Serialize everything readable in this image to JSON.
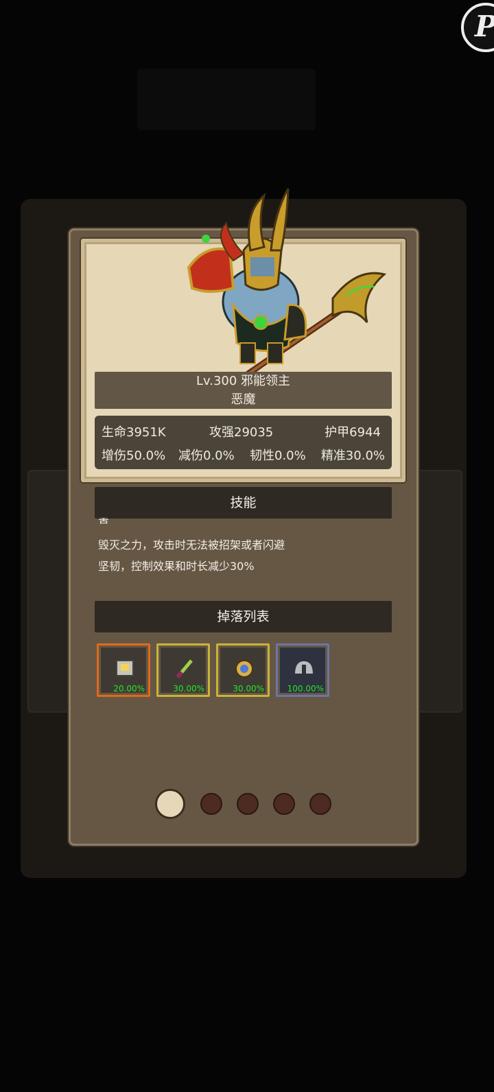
{
  "corner_button": {
    "glyph": "P"
  },
  "monster": {
    "name_line": "Lv.300 邪能领主",
    "type": "恶魔"
  },
  "stats": {
    "hp": "生命3951K",
    "attack": "攻强29035",
    "armor": "护甲6944",
    "dmg_bonus": "增伤50.0%",
    "dmg_reduce": "减伤0.0%",
    "toughness": "韧性0.0%",
    "accuracy": "精准30.0%"
  },
  "skills": {
    "header": "技能",
    "cut_line": "害",
    "lines": [
      "毁灭之力，攻击时无法被招架或者闪避",
      "坚韧，控制效果和时长减少30%"
    ]
  },
  "drops": {
    "header": "掉落列表",
    "items": [
      {
        "icon": "scroll-icon",
        "chance": "20.00%",
        "rarity_color": "#e06a18"
      },
      {
        "icon": "dagger-icon",
        "chance": "30.00%",
        "rarity_color": "#c8b437"
      },
      {
        "icon": "amulet-icon",
        "chance": "30.00%",
        "rarity_color": "#c8b437"
      },
      {
        "icon": "helmet-icon",
        "chance": "100.00%",
        "rarity_color": "#6a76a8"
      }
    ]
  },
  "pager": {
    "page_count": 5,
    "current_page": 1
  }
}
